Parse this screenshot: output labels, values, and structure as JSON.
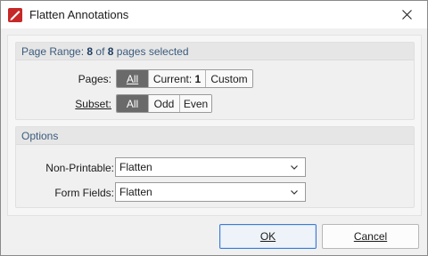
{
  "window": {
    "title": "Flatten Annotations",
    "icon": "app-logo-icon",
    "close_icon": "close-icon"
  },
  "page_range": {
    "header_prefix": "Page Range: ",
    "selected": "8",
    "of_text": " of ",
    "total": "8",
    "suffix": " pages selected",
    "pages_label": "Pages:",
    "pages_options": [
      {
        "label": "All",
        "active": true
      },
      {
        "label_prefix": "Current: ",
        "label_value": "1",
        "active": false
      },
      {
        "label": "Custom",
        "active": false
      }
    ],
    "subset_label": "Subset:",
    "subset_options": [
      {
        "label": "All",
        "active": true
      },
      {
        "label": "Odd",
        "active": false
      },
      {
        "label": "Even",
        "active": false
      }
    ]
  },
  "options": {
    "header": "Options",
    "non_printable_label": "Non-Printable:",
    "non_printable_value": "Flatten",
    "form_fields_label": "Form Fields:",
    "form_fields_value": "Flatten"
  },
  "buttons": {
    "ok": "OK",
    "cancel": "Cancel"
  },
  "colors": {
    "active_segment": "#6a6a6a",
    "header_text": "#3b5b7c",
    "ok_border": "#3b7bd6"
  }
}
